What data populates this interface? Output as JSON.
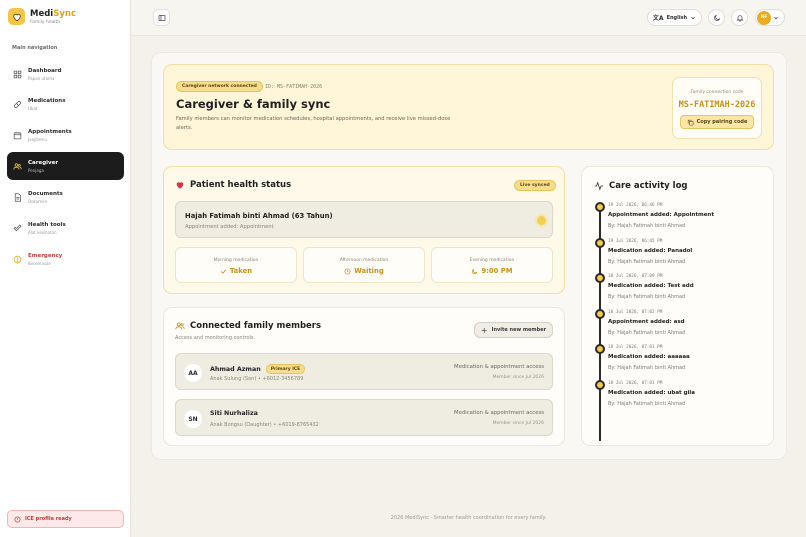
{
  "app": {
    "name_prefix": "Medi",
    "name_suffix": "Sync",
    "tagline": "Family health"
  },
  "sidebar": {
    "heading": "Main navigation",
    "items": [
      {
        "label": "Dashboard",
        "sub": "Papan utama",
        "icon": "grid-icon"
      },
      {
        "label": "Medications",
        "sub": "Ubat",
        "icon": "pill-icon"
      },
      {
        "label": "Appointments",
        "sub": "Janjitemu",
        "icon": "calendar-icon"
      },
      {
        "label": "Caregiver",
        "sub": "Penjaga",
        "icon": "users-icon",
        "active": true
      },
      {
        "label": "Documents",
        "sub": "Dokumen",
        "icon": "document-icon"
      },
      {
        "label": "Health tools",
        "sub": "Alat kesihatan",
        "icon": "tools-icon"
      },
      {
        "label": "Emergency",
        "sub": "Kecemasan",
        "icon": "alert-icon"
      }
    ],
    "ice_status": "ICE profile ready"
  },
  "topbar": {
    "language": "English",
    "avatar_initials": "NF"
  },
  "hero": {
    "chip": "Caregiver network connected",
    "id_text": "ID: MS-FATIMAH-2026",
    "title": "Caregiver & family sync",
    "description": "Family members can monitor medication schedules, hospital appointments, and receive live missed-dose alerts.",
    "code_label": "Family connection code",
    "code_value": "MS-FATIMAH-2026",
    "copy_label": "Copy pairing code"
  },
  "status": {
    "title": "Patient health status",
    "live_chip": "Live synced",
    "patient_name": "Hajah Fatimah binti Ahmad (63 Tahun)",
    "patient_sub": "Appointment added: Appointment",
    "meds": [
      {
        "label": "Morning medication",
        "value": "Taken",
        "icon": "check-icon"
      },
      {
        "label": "Afternoon medication",
        "value": "Waiting",
        "icon": "clock-icon"
      },
      {
        "label": "Evening medication",
        "value": "9:00 PM",
        "icon": "moon-icon"
      }
    ]
  },
  "activity": {
    "title": "Care activity log",
    "entries": [
      {
        "time": "19 Jul 2026, 06:46 PM",
        "action": "Appointment added: Appointment",
        "by": "By: Hajah Fatimah binti Ahmad"
      },
      {
        "time": "19 Jul 2026, 06:45 PM",
        "action": "Medication added: Panadol",
        "by": "By: Hajah Fatimah binti Ahmad"
      },
      {
        "time": "18 Jul 2026, 07:09 PM",
        "action": "Medication added: Test add",
        "by": "By: Hajah Fatimah binti Ahmad"
      },
      {
        "time": "18 Jul 2026, 07:02 PM",
        "action": "Appointment added: asd",
        "by": "By: Hajah Fatimah binti Ahmad"
      },
      {
        "time": "18 Jul 2026, 07:01 PM",
        "action": "Medication added: aaaaaa",
        "by": "By: Hajah Fatimah binti Ahmad"
      },
      {
        "time": "18 Jul 2026, 07:01 PM",
        "action": "Medication added: ubat gila",
        "by": "By: Hajah Fatimah binti Ahmad"
      }
    ]
  },
  "family": {
    "title": "Connected family members",
    "subtitle": "Access and monitoring controls.",
    "invite_label": "Invite new member",
    "members": [
      {
        "initials": "AA",
        "name": "Ahmad Azman",
        "tag": "Primary ICE",
        "relation": "Anak Sulung (Son) • +6012-3456789",
        "access": "Medication & appointment access",
        "since": "Member since Jul 2026"
      },
      {
        "initials": "SN",
        "name": "Siti Nurhaliza",
        "tag": "",
        "relation": "Anak Bongsu (Daughter) • +6019-8765432",
        "access": "Medication & appointment access",
        "since": "Member since Jul 2026"
      }
    ]
  },
  "footer": "2026 MediSync · Smarter health coordination for every family.",
  "colors": {
    "accent": "#f2c94c",
    "active_nav": "#1c1c1c",
    "emergency": "#c83c3c"
  }
}
